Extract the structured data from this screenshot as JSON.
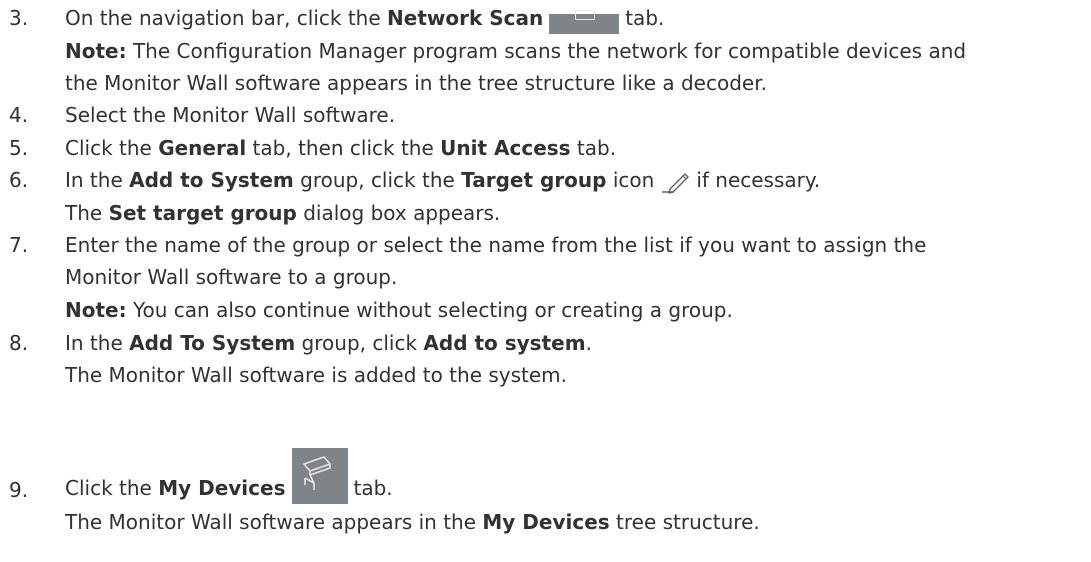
{
  "steps": [
    {
      "number": "3.",
      "lines": [
        {
          "parts": [
            "On the navigation bar, click the ",
            "Network Scan",
            "tab."
          ]
        },
        {
          "parts": [
            "Note:",
            " The Configuration Manager program scans the network for compatible devices and"
          ]
        },
        {
          "parts": [
            "the Monitor Wall software appears in the tree structure like a decoder."
          ]
        }
      ]
    },
    {
      "number": "4.",
      "lines": [
        {
          "parts": [
            "Select the Monitor Wall software."
          ]
        }
      ]
    },
    {
      "number": "5.",
      "lines": [
        {
          "parts": [
            "Click the ",
            "General",
            " tab, then click the ",
            "Unit Access",
            " tab."
          ]
        }
      ]
    },
    {
      "number": "6.",
      "lines": [
        {
          "parts": [
            "In the ",
            "Add to System",
            " group, click the ",
            "Target group",
            " icon",
            "if necessary."
          ]
        },
        {
          "parts": [
            "The ",
            "Set target group",
            " dialog box appears."
          ]
        }
      ]
    },
    {
      "number": "7.",
      "lines": [
        {
          "parts": [
            "Enter the name of the group or select the name from the list if you want to assign the"
          ]
        },
        {
          "parts": [
            "Monitor Wall software to a group."
          ]
        },
        {
          "parts": [
            "Note:",
            " You can also continue without selecting or creating a group."
          ]
        }
      ]
    },
    {
      "number": "8.",
      "lines": [
        {
          "parts": [
            "In the ",
            "Add To System",
            " group, click ",
            "Add to system",
            "."
          ]
        },
        {
          "parts": [
            "The Monitor Wall software is added to the system."
          ]
        }
      ]
    },
    {
      "number": "9.",
      "lines": [
        {
          "parts": [
            "Click the ",
            "My Devices",
            "tab."
          ]
        },
        {
          "parts": [
            "The Monitor Wall software appears in the ",
            "My Devices",
            " tree structure."
          ]
        }
      ]
    }
  ],
  "icons": {
    "network_scan": "network-scan-icon",
    "target_group": "pencil-icon",
    "my_devices": "camera-icon"
  },
  "colors": {
    "text": "#323232",
    "icon_bg": "#7f8489"
  }
}
